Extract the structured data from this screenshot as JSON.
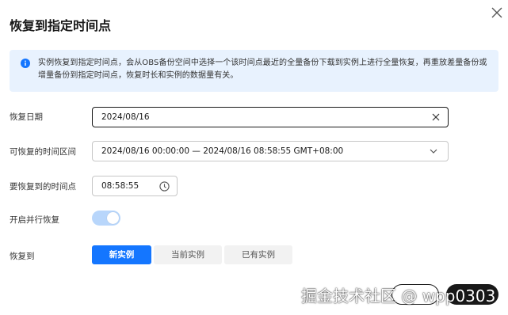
{
  "dialog": {
    "title": "恢复到指定时间点"
  },
  "info": {
    "text": "实例恢复到指定时间点，会从OBS备份空间中选择一个该时间点最近的全量备份下载到实例上进行全量恢复，再重放差量备份或增量备份到指定时间点，恢复时长和实例的数据量有关。"
  },
  "form": {
    "restore_date": {
      "label": "恢复日期",
      "value": "2024/08/16"
    },
    "time_range": {
      "label": "可恢复的时间区间",
      "value": "2024/08/16 00:00:00 — 2024/08/16 08:58:55 GMT+08:00"
    },
    "restore_time": {
      "label": "要恢复到的时间点",
      "value": "08:58:55"
    },
    "parallel": {
      "label": "开启并行恢复",
      "enabled": true
    },
    "restore_to": {
      "label": "恢复到",
      "options": [
        "新实例",
        "当前实例",
        "已有实例"
      ],
      "selected": "新实例"
    }
  },
  "footer": {
    "watermark": "掘金技术社区 @ wpp0303"
  },
  "colors": {
    "primary": "#1476ff",
    "info_bg": "#e8f2fe",
    "toggle_on": "#b8d6fb"
  },
  "icons": [
    "close-icon",
    "info-icon",
    "clear-icon",
    "chevron-down-icon",
    "clock-icon"
  ]
}
